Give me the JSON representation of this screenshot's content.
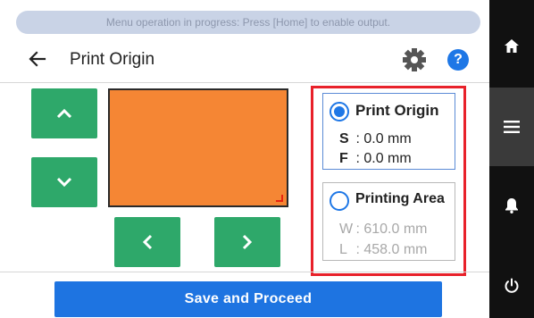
{
  "status_message": "Menu operation in progress: Press [Home] to enable output.",
  "header": {
    "title": "Print Origin",
    "back_icon": "back-arrow-icon",
    "settings_icon": "gear-icon",
    "help_label": "?"
  },
  "jog_buttons": {
    "up_icon": "chevron-up-icon",
    "down_icon": "chevron-down-icon",
    "left_icon": "chevron-left-icon",
    "right_icon": "chevron-right-icon"
  },
  "options": {
    "print_origin": {
      "label": "Print Origin",
      "selected": true,
      "rows": [
        {
          "key": "S",
          "value": ": 0.0 mm"
        },
        {
          "key": "F",
          "value": ": 0.0 mm"
        }
      ]
    },
    "printing_area": {
      "label": "Printing Area",
      "selected": false,
      "rows": [
        {
          "key": "W",
          "value": ": 610.0 mm"
        },
        {
          "key": "L",
          "value": ": 458.0 mm"
        }
      ]
    }
  },
  "save_button_label": "Save and Proceed",
  "side_nav": [
    "home-icon",
    "menu-icon",
    "bell-icon",
    "power-icon"
  ],
  "colors": {
    "accent_blue": "#1e74e1",
    "jog_green": "#2ea86a",
    "preview_orange": "#f58634",
    "highlight_red": "#e8212a"
  }
}
